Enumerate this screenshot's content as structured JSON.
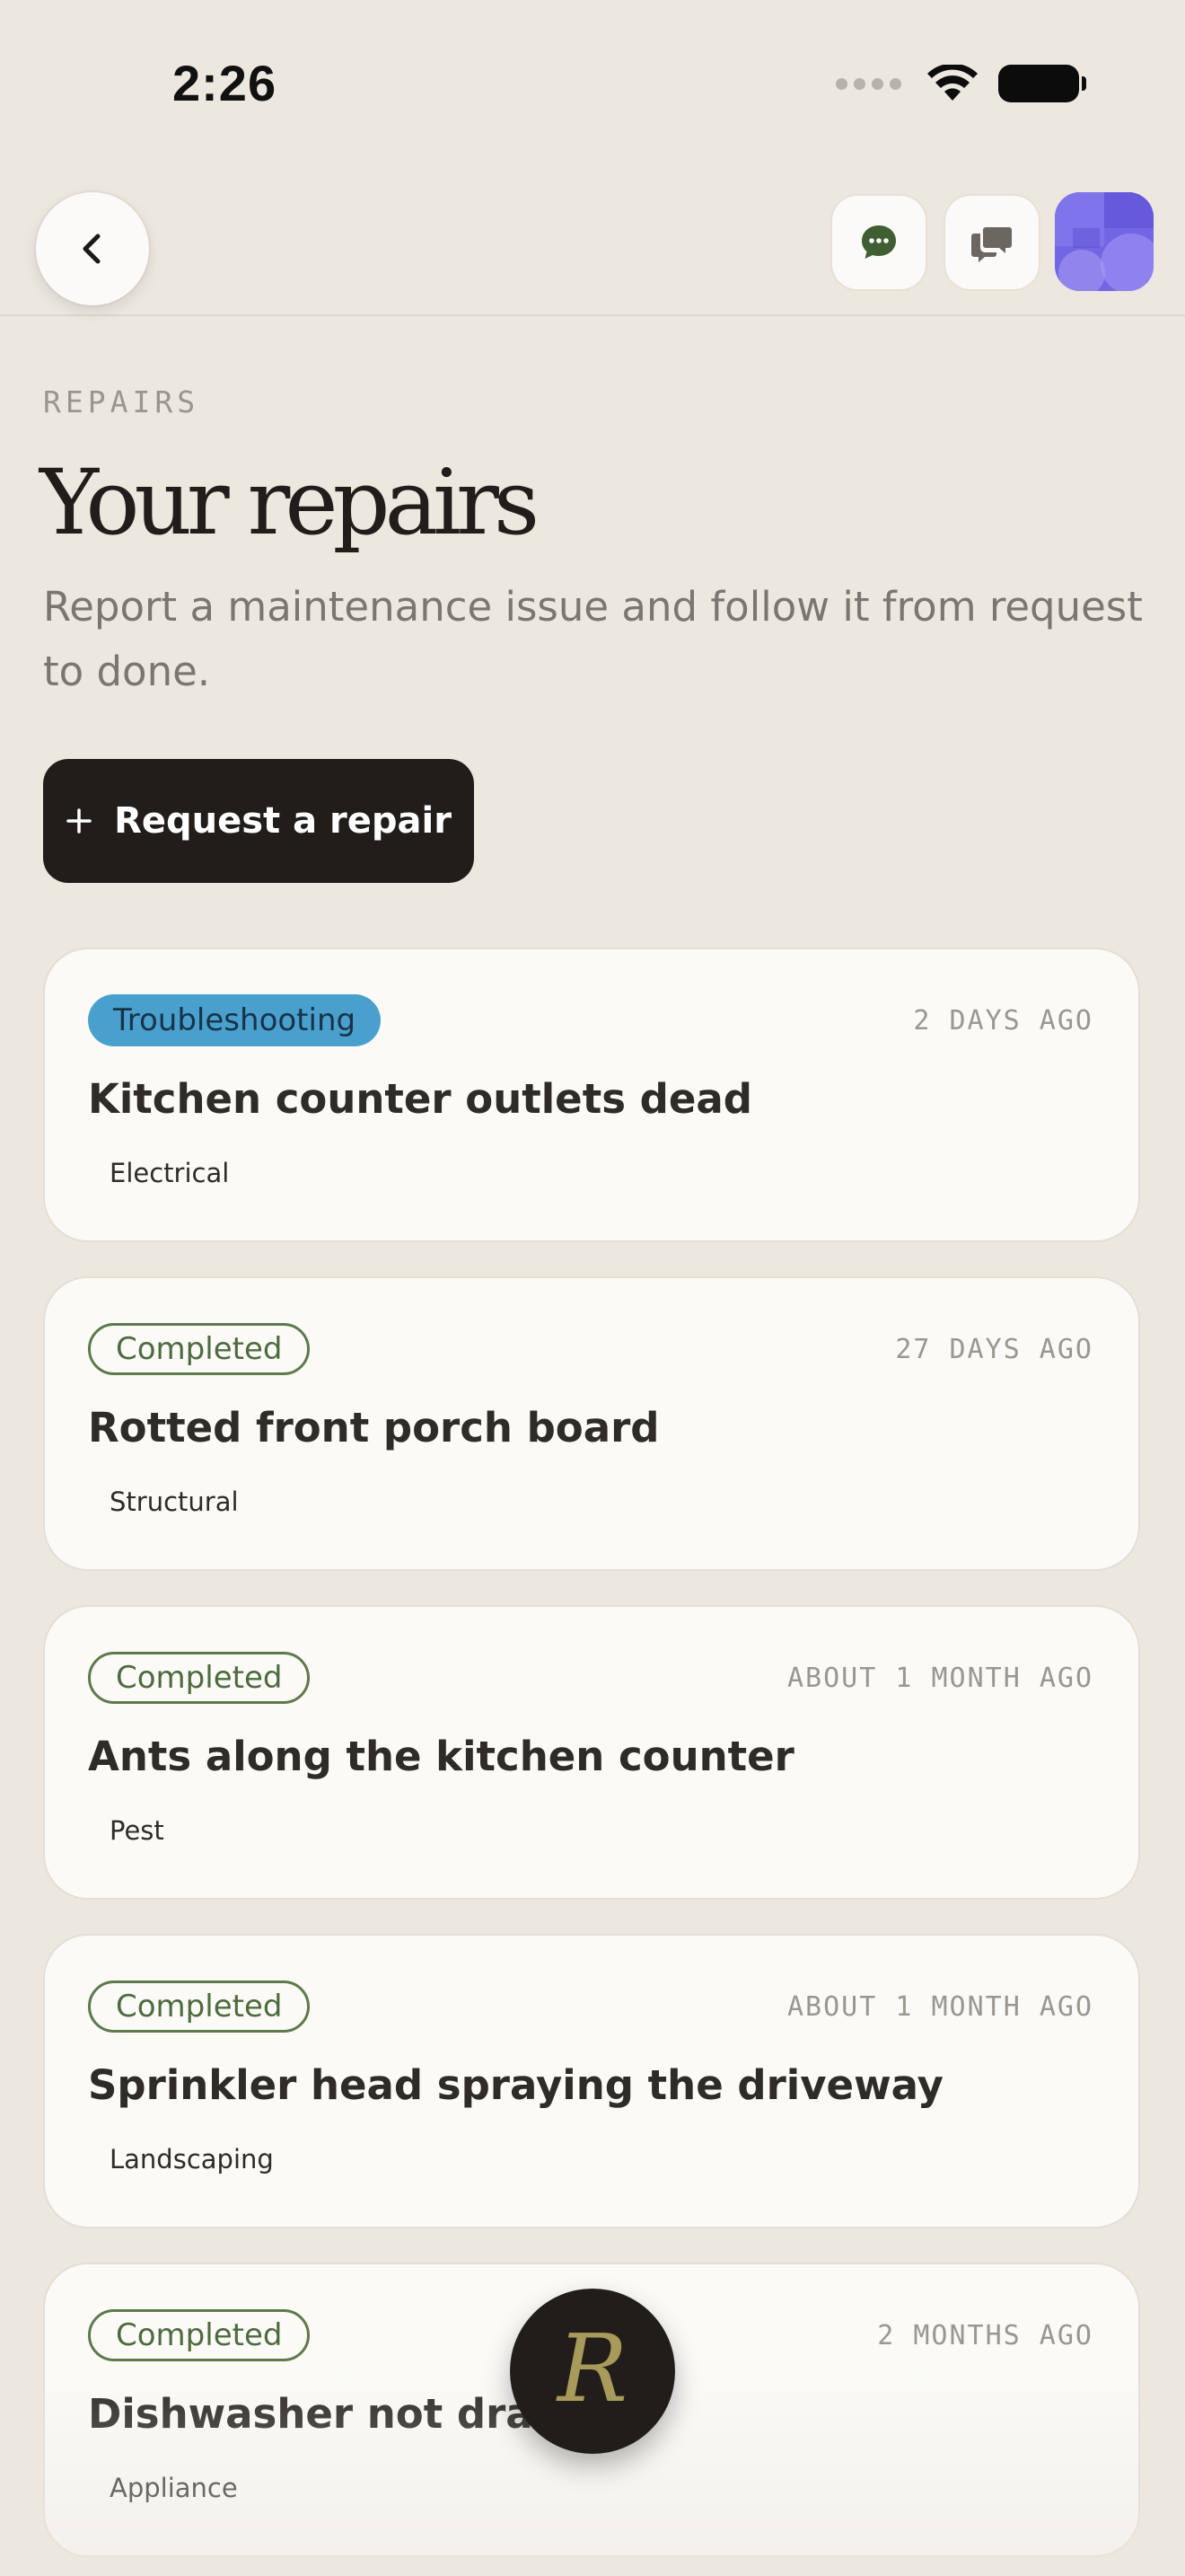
{
  "status_bar": {
    "time": "2:26"
  },
  "header": {
    "eyebrow": "REPAIRS",
    "title": "Your repairs",
    "subtitle": "Report a maintenance issue and follow it from request to done.",
    "request_button_label": "Request a repair",
    "request_button_icon": "plus-icon"
  },
  "toolbar": {
    "back_icon": "chevron-left-icon",
    "chat_icon": "chat-bubble-icon",
    "messages_icon": "messages-icon",
    "avatar_color": "#7b6fe6"
  },
  "colors": {
    "background": "#ece7df",
    "troubleshooting": "#4aa0cc",
    "completed": "#5d7a4c",
    "dark_button": "#211d1a"
  },
  "repairs": [
    {
      "status": "Troubleshooting",
      "time_ago": "2 DAYS AGO",
      "title": "Kitchen counter outlets dead",
      "category": "Electrical"
    },
    {
      "status": "Completed",
      "time_ago": "27 DAYS AGO",
      "title": "Rotted front porch board",
      "category": "Structural"
    },
    {
      "status": "Completed",
      "time_ago": "ABOUT 1 MONTH AGO",
      "title": "Ants along the kitchen counter",
      "category": "Pest"
    },
    {
      "status": "Completed",
      "time_ago": "ABOUT 1 MONTH AGO",
      "title": "Sprinkler head spraying the driveway",
      "category": "Landscaping"
    },
    {
      "status": "Completed",
      "time_ago": "2 MONTHS AGO",
      "title": "Dishwasher not draining",
      "category": "Appliance"
    }
  ],
  "fab": {
    "letter": "R"
  }
}
